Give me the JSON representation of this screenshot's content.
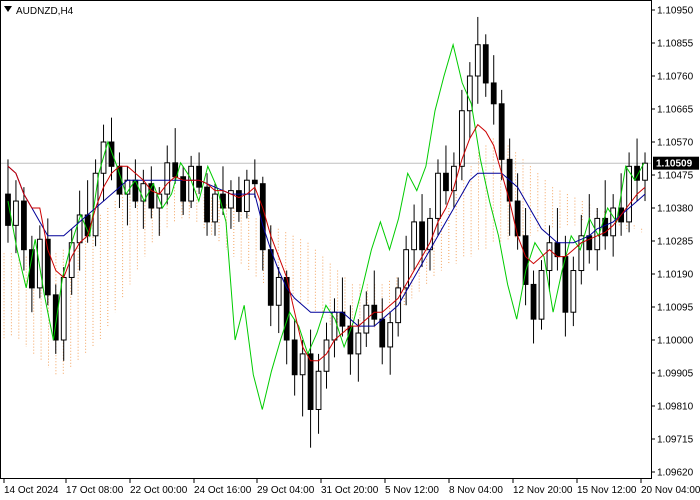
{
  "chart_data": {
    "type": "candlestick",
    "symbol": "AUDNZD,H4",
    "y_ticks": [
      "1.10950",
      "1.10855",
      "1.10760",
      "1.10665",
      "1.10570",
      "1.10475",
      "1.10380",
      "1.10285",
      "1.10190",
      "1.10095",
      "1.10000",
      "1.09905",
      "1.09810",
      "1.09715",
      "1.09620"
    ],
    "y_tick_values": [
      1.1095,
      1.10855,
      1.1076,
      1.10665,
      1.1057,
      1.10475,
      1.1038,
      1.10285,
      1.1019,
      1.10095,
      1.1,
      1.09905,
      1.0981,
      1.09715,
      1.0962
    ],
    "ylim": [
      1.0962,
      1.1095
    ],
    "x_labels": [
      "14 Oct 2024",
      "17 Oct 08:00",
      "22 Oct 00:00",
      "24 Oct 16:00",
      "29 Oct 04:00",
      "31 Oct 20:00",
      "5 Nov 12:00",
      "8 Nov 04:00",
      "12 Nov 20:00",
      "15 Nov 12:00",
      "20 Nov 04:00"
    ],
    "current_price": "1.10509",
    "current_price_value": 1.10509,
    "grid": false,
    "colors": {
      "candle": "#000000",
      "tenkan_sen": "#cc0000",
      "kijun_sen": "#000099",
      "chikou_span": "#00cc00",
      "cloud_bullish": "#f4a460",
      "cloud_bearish": "#c8c8c8",
      "price_line": "#c0c0c0"
    },
    "ohlc": [
      [
        1.1042,
        1.1052,
        1.1028,
        1.1033
      ],
      [
        1.1033,
        1.1046,
        1.1025,
        1.104
      ],
      [
        1.104,
        1.1044,
        1.102,
        1.1026
      ],
      [
        1.1026,
        1.103,
        1.1008,
        1.1015
      ],
      [
        1.1015,
        1.1033,
        1.1012,
        1.1029
      ],
      [
        1.1029,
        1.1035,
        1.101,
        1.1013
      ],
      [
        1.1013,
        1.1016,
        1.0996,
        1.1
      ],
      [
        1.1,
        1.1021,
        1.0994,
        1.1018
      ],
      [
        1.1018,
        1.1032,
        1.1013,
        1.1028
      ],
      [
        1.1028,
        1.1043,
        1.102,
        1.1036
      ],
      [
        1.1036,
        1.1046,
        1.1028,
        1.103
      ],
      [
        1.103,
        1.1052,
        1.1027,
        1.1048
      ],
      [
        1.1048,
        1.1062,
        1.104,
        1.1057
      ],
      [
        1.1057,
        1.1064,
        1.1046,
        1.105
      ],
      [
        1.105,
        1.1054,
        1.1038,
        1.1042
      ],
      [
        1.1042,
        1.105,
        1.1033,
        1.1046
      ],
      [
        1.1046,
        1.1052,
        1.1038,
        1.104
      ],
      [
        1.104,
        1.1049,
        1.1032,
        1.1045
      ],
      [
        1.1045,
        1.105,
        1.1035,
        1.1038
      ],
      [
        1.1038,
        1.1044,
        1.103,
        1.1042
      ],
      [
        1.1042,
        1.1056,
        1.1039,
        1.1051
      ],
      [
        1.1051,
        1.1061,
        1.1045,
        1.1047
      ],
      [
        1.1047,
        1.105,
        1.1036,
        1.104
      ],
      [
        1.104,
        1.1053,
        1.1038,
        1.105
      ],
      [
        1.105,
        1.1054,
        1.1042,
        1.1044
      ],
      [
        1.1044,
        1.1048,
        1.103,
        1.1034
      ],
      [
        1.1034,
        1.1045,
        1.103,
        1.1042
      ],
      [
        1.1042,
        1.105,
        1.1036,
        1.1038
      ],
      [
        1.1038,
        1.1046,
        1.1032,
        1.1043
      ],
      [
        1.1043,
        1.1047,
        1.1034,
        1.1037
      ],
      [
        1.1037,
        1.1049,
        1.1035,
        1.1046
      ],
      [
        1.1046,
        1.1052,
        1.1041,
        1.1045
      ],
      [
        1.1045,
        1.1047,
        1.102,
        1.1026
      ],
      [
        1.1026,
        1.1033,
        1.1004,
        1.101
      ],
      [
        1.101,
        1.1021,
        1.1002,
        1.1018
      ],
      [
        1.1018,
        1.102,
        1.0993,
        1.1
      ],
      [
        1.1,
        1.1006,
        1.0984,
        1.099
      ],
      [
        1.099,
        1.1,
        1.0978,
        1.0996
      ],
      [
        1.0996,
        1.1003,
        1.0969,
        1.098
      ],
      [
        1.098,
        1.0996,
        1.0973,
        1.0991
      ],
      [
        1.0991,
        1.1005,
        1.0986,
        1.1
      ],
      [
        1.1,
        1.1012,
        1.0995,
        1.1008
      ],
      [
        1.1008,
        1.1018,
        1.1001,
        1.1004
      ],
      [
        1.1004,
        1.101,
        1.099,
        1.0996
      ],
      [
        1.0996,
        1.1006,
        1.0988,
        1.1002
      ],
      [
        1.1002,
        1.1014,
        1.0998,
        1.101
      ],
      [
        1.101,
        1.102,
        1.1004,
        1.1006
      ],
      [
        1.1006,
        1.1012,
        1.0993,
        1.0998
      ],
      [
        1.0998,
        1.1008,
        1.099,
        1.1005
      ],
      [
        1.1005,
        1.1018,
        1.1001,
        1.1015
      ],
      [
        1.1015,
        1.103,
        1.101,
        1.1026
      ],
      [
        1.1026,
        1.1039,
        1.102,
        1.1034
      ],
      [
        1.1034,
        1.1042,
        1.1021,
        1.1026
      ],
      [
        1.1026,
        1.1038,
        1.102,
        1.1035
      ],
      [
        1.1035,
        1.1052,
        1.103,
        1.1048
      ],
      [
        1.1048,
        1.1056,
        1.1039,
        1.1043
      ],
      [
        1.1043,
        1.1054,
        1.1038,
        1.105
      ],
      [
        1.105,
        1.1072,
        1.1046,
        1.1066
      ],
      [
        1.1066,
        1.108,
        1.1058,
        1.1076
      ],
      [
        1.1076,
        1.1093,
        1.1068,
        1.1085
      ],
      [
        1.1085,
        1.1088,
        1.107,
        1.1074
      ],
      [
        1.1074,
        1.1082,
        1.1062,
        1.1068
      ],
      [
        1.1068,
        1.1072,
        1.1046,
        1.1052
      ],
      [
        1.1052,
        1.1058,
        1.103,
        1.104
      ],
      [
        1.104,
        1.1048,
        1.1026,
        1.103
      ],
      [
        1.103,
        1.1038,
        1.101,
        1.1016
      ],
      [
        1.1016,
        1.102,
        1.0999,
        1.1006
      ],
      [
        1.1006,
        1.1023,
        1.1003,
        1.102
      ],
      [
        1.102,
        1.1033,
        1.1014,
        1.1028
      ],
      [
        1.1028,
        1.1038,
        1.102,
        1.1024
      ],
      [
        1.1024,
        1.103,
        1.1001,
        1.1008
      ],
      [
        1.1008,
        1.1024,
        1.1004,
        1.102
      ],
      [
        1.102,
        1.1036,
        1.1016,
        1.103
      ],
      [
        1.103,
        1.1042,
        1.1022,
        1.1026
      ],
      [
        1.1026,
        1.1038,
        1.102,
        1.1035
      ],
      [
        1.1035,
        1.1046,
        1.1026,
        1.103
      ],
      [
        1.103,
        1.1042,
        1.1024,
        1.1038
      ],
      [
        1.1038,
        1.1048,
        1.103,
        1.1034
      ],
      [
        1.1034,
        1.1054,
        1.1031,
        1.105
      ],
      [
        1.105,
        1.1058,
        1.104,
        1.1046
      ],
      [
        1.1046,
        1.1054,
        1.104,
        1.10509
      ]
    ],
    "tenkan_sen": [
      1.105,
      1.1048,
      1.1042,
      1.1038,
      1.1038,
      1.1026,
      1.102,
      1.1018,
      1.1024,
      1.1028,
      1.103,
      1.1038,
      1.1044,
      1.1048,
      1.105,
      1.105,
      1.1048,
      1.1046,
      1.1043,
      1.1042,
      1.1045,
      1.1047,
      1.1046,
      1.1046,
      1.1046,
      1.1045,
      1.1043,
      1.1043,
      1.1042,
      1.1041,
      1.1042,
      1.1044,
      1.1038,
      1.103,
      1.1024,
      1.1018,
      1.1008,
      1.0998,
      1.0994,
      1.0994,
      1.0996,
      1.1,
      1.1002,
      1.1004,
      1.1004,
      1.1006,
      1.1008,
      1.1008,
      1.101,
      1.1012,
      1.1016,
      1.102,
      1.1024,
      1.1028,
      1.1034,
      1.1038,
      1.1044,
      1.1052,
      1.1058,
      1.1062,
      1.106,
      1.1056,
      1.1048,
      1.104,
      1.103,
      1.1024,
      1.1022,
      1.1024,
      1.1026,
      1.1024,
      1.1024,
      1.1026,
      1.1028,
      1.1029,
      1.103,
      1.1031,
      1.1033,
      1.1036,
      1.1039,
      1.1042,
      1.1044
    ],
    "kijun_sen": [
      1.105,
      1.1048,
      1.1042,
      1.1038,
      1.1034,
      1.103,
      1.103,
      1.103,
      1.1032,
      1.1034,
      1.1036,
      1.1038,
      1.104,
      1.1042,
      1.1044,
      1.1046,
      1.1046,
      1.1046,
      1.1046,
      1.1046,
      1.1046,
      1.1046,
      1.1046,
      1.1046,
      1.1046,
      1.1045,
      1.1044,
      1.1043,
      1.1042,
      1.1042,
      1.1042,
      1.1042,
      1.1033,
      1.1026,
      1.102,
      1.1015,
      1.1012,
      1.101,
      1.1008,
      1.1008,
      1.1008,
      1.1008,
      1.1008,
      1.1006,
      1.1004,
      1.1004,
      1.1004,
      1.1006,
      1.1008,
      1.101,
      1.1014,
      1.1018,
      1.1022,
      1.1026,
      1.103,
      1.1034,
      1.1038,
      1.1042,
      1.1046,
      1.1048,
      1.1048,
      1.1048,
      1.1048,
      1.1046,
      1.1044,
      1.104,
      1.1036,
      1.1032,
      1.103,
      1.1028,
      1.1028,
      1.1028,
      1.1029,
      1.103,
      1.1032,
      1.1033,
      1.1034,
      1.1036,
      1.1038,
      1.104,
      1.1042
    ],
    "chikou_span": [
      1.104,
      1.1026,
      1.1015,
      1.1029,
      1.1013,
      1.1,
      1.1018,
      1.1028,
      1.1036,
      1.103,
      1.1048,
      1.1057,
      1.105,
      1.1042,
      1.1046,
      1.104,
      1.1045,
      1.1038,
      1.1042,
      1.1051,
      1.1047,
      1.104,
      1.105,
      1.1044,
      1.1034,
      1.1,
      1.101,
      1.099,
      1.098,
      1.0991,
      1.1,
      1.1008,
      1.1004,
      1.0996,
      1.1002,
      1.101,
      1.1006,
      1.0998,
      1.1005,
      1.1015,
      1.1026,
      1.1034,
      1.1026,
      1.1035,
      1.1048,
      1.1043,
      1.105,
      1.1066,
      1.1076,
      1.1085,
      1.1074,
      1.1068,
      1.1052,
      1.104,
      1.103,
      1.1016,
      1.1006,
      1.102,
      1.1028,
      1.1024,
      1.1008,
      1.102,
      1.103,
      1.1026,
      1.1035,
      1.103,
      1.1038,
      1.1034,
      1.105,
      1.1046,
      1.10509
    ],
    "cloud": [
      [
        1.1025,
        1.1
      ],
      [
        1.1025,
        1.1001
      ],
      [
        1.1024,
        1.1
      ],
      [
        1.1024,
        1.0998
      ],
      [
        1.1024,
        1.0996
      ],
      [
        1.1024,
        1.0994
      ],
      [
        1.1024,
        1.0992
      ],
      [
        1.1025,
        1.099
      ],
      [
        1.1026,
        1.099
      ],
      [
        1.1028,
        1.0992
      ],
      [
        1.103,
        1.0994
      ],
      [
        1.1032,
        1.0996
      ],
      [
        1.1034,
        1.0998
      ],
      [
        1.1036,
        1.1
      ],
      [
        1.1038,
        1.1004
      ],
      [
        1.104,
        1.1008
      ],
      [
        1.1042,
        1.1012
      ],
      [
        1.1043,
        1.1016
      ],
      [
        1.1044,
        1.102
      ],
      [
        1.1044,
        1.1024
      ],
      [
        1.1044,
        1.1028
      ],
      [
        1.1044,
        1.103
      ],
      [
        1.1044,
        1.1032
      ],
      [
        1.1044,
        1.1034
      ],
      [
        1.1044,
        1.1035
      ],
      [
        1.1044,
        1.1035
      ],
      [
        1.1043,
        1.1034
      ],
      [
        1.1042,
        1.1032
      ],
      [
        1.1041,
        1.103
      ],
      [
        1.104,
        1.1028
      ],
      [
        1.1039,
        1.1026
      ],
      [
        1.1038,
        1.1024
      ],
      [
        1.1037,
        1.1022
      ],
      [
        1.1036,
        1.102
      ],
      [
        1.1035,
        1.1018
      ],
      [
        1.1034,
        1.1016
      ],
      [
        1.1033,
        1.1014
      ],
      [
        1.1032,
        1.1013
      ],
      [
        1.1031,
        1.1012
      ],
      [
        1.103,
        1.1011
      ],
      [
        1.1029,
        1.101
      ],
      [
        1.1028,
        1.101
      ],
      [
        1.1026,
        1.1008
      ],
      [
        1.1024,
        1.1006
      ],
      [
        1.1022,
        1.1004
      ],
      [
        1.102,
        1.1003
      ],
      [
        1.1018,
        1.1002
      ],
      [
        1.1016,
        1.1002
      ],
      [
        1.1016,
        1.1002
      ],
      [
        1.1016,
        1.1002
      ],
      [
        1.1016,
        1.1003
      ],
      [
        1.1016,
        1.1004
      ],
      [
        1.1017,
        1.1006
      ],
      [
        1.1018,
        1.1008
      ],
      [
        1.1019,
        1.101
      ],
      [
        1.102,
        1.1012
      ],
      [
        1.1022,
        1.1014
      ],
      [
        1.1026,
        1.1016
      ],
      [
        1.103,
        1.1018
      ],
      [
        1.1034,
        1.102
      ],
      [
        1.1038,
        1.1022
      ],
      [
        1.1042,
        1.1022
      ],
      [
        1.1046,
        1.1024
      ],
      [
        1.105,
        1.1024
      ],
      [
        1.1054,
        1.1026
      ],
      [
        1.1056,
        1.1026
      ],
      [
        1.1058,
        1.1028
      ],
      [
        1.1058,
        1.1028
      ],
      [
        1.1056,
        1.1029
      ],
      [
        1.1054,
        1.1029
      ],
      [
        1.1052,
        1.103
      ],
      [
        1.105,
        1.103
      ],
      [
        1.1048,
        1.1031
      ],
      [
        1.1046,
        1.1031
      ],
      [
        1.1044,
        1.1032
      ],
      [
        1.1043,
        1.1032
      ],
      [
        1.1042,
        1.1033
      ],
      [
        1.1041,
        1.1033
      ],
      [
        1.104,
        1.1034
      ],
      [
        1.1039,
        1.1034
      ],
      [
        1.1038,
        1.1034
      ],
      [
        1.1037,
        1.1034
      ],
      [
        1.1036,
        1.1033
      ],
      [
        1.1035,
        1.1033
      ],
      [
        1.1034,
        1.1032
      ],
      [
        1.1033,
        1.1032
      ],
      [
        1.1032,
        1.1031
      ]
    ]
  }
}
